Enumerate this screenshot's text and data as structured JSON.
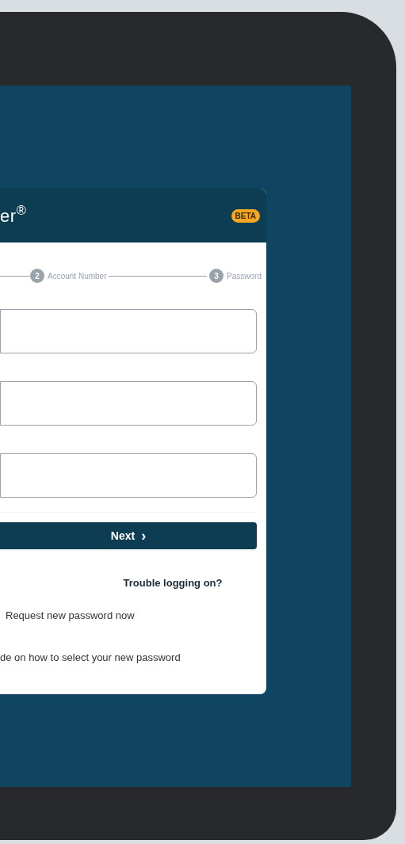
{
  "card": {
    "title": "er$^{®}$",
    "badge": "BETA"
  },
  "steps": [
    {
      "number": "2",
      "label": "Account Number"
    },
    {
      "number": "3",
      "label": "Password"
    }
  ],
  "next_button": {
    "label": "Next",
    "icon": "›"
  },
  "help": {
    "heading": "Trouble logging on?",
    "links": [
      "Request new password now",
      "de on how to select your new password"
    ]
  }
}
